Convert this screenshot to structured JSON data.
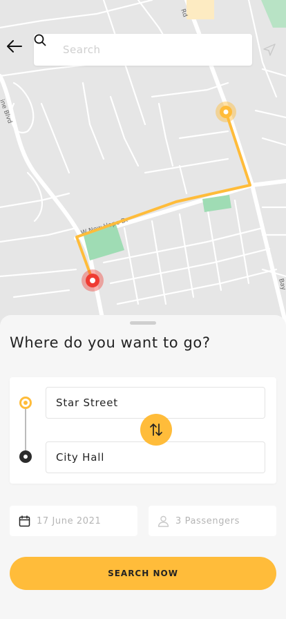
{
  "colors": {
    "accent": "#ffbc3a",
    "destination_marker": "#ef3b32",
    "dark_dot": "#2b2b2b",
    "map_background": "#e6e6e6",
    "map_roads": "#ffffff",
    "park_green": "#9fdcb4"
  },
  "map": {
    "street_labels": [
      "W New Hope Dr",
      "Rd",
      "ine Blvd",
      "Bay"
    ],
    "icons": [
      "origin-marker",
      "destination-marker",
      "route-line"
    ]
  },
  "header": {
    "back_icon": "arrow-left-icon",
    "search_placeholder": "Search",
    "search_icon": "search-icon",
    "locate_icon": "navigation-arrow-icon"
  },
  "sheet": {
    "title": "Where do you want to go?",
    "origin": "Star Street",
    "destination": "City Hall",
    "swap_icon": "swap-vertical-icon",
    "date": "17 June 2021",
    "date_icon": "calendar-icon",
    "passengers": "3 Passengers",
    "passengers_icon": "person-icon",
    "cta_label": "SEARCH NOW"
  }
}
